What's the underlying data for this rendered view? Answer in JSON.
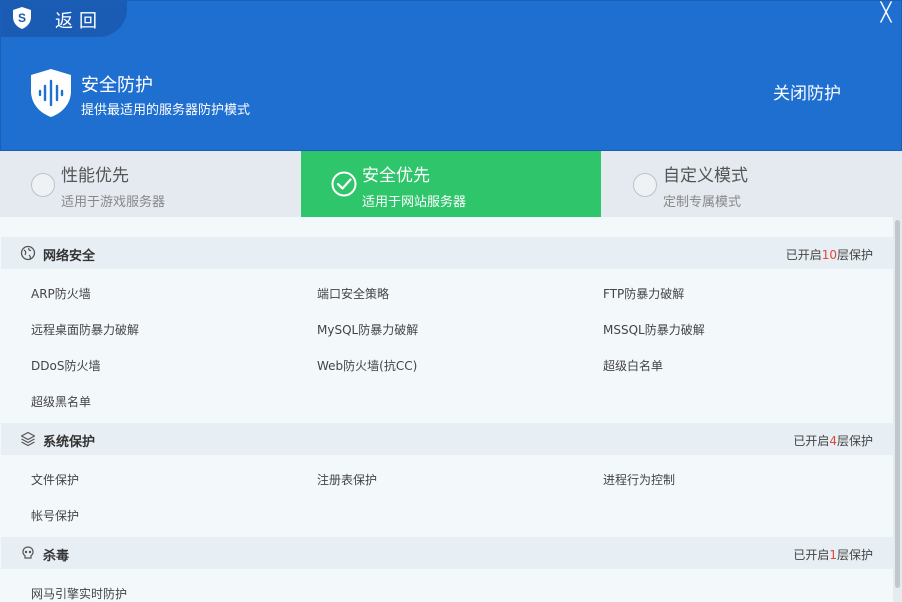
{
  "header": {
    "back_label": "返回",
    "close_glyph": "╳",
    "title": "安全防护",
    "subtitle": "提供最适用的服务器防护模式",
    "close_protect_label": "关闭防护",
    "bg_color": "#1f6fd1"
  },
  "modes": [
    {
      "title": "性能优先",
      "subtitle": "适用于游戏服务器",
      "selected": false
    },
    {
      "title": "安全优先",
      "subtitle": "适用于网站服务器",
      "selected": true
    },
    {
      "title": "自定义模式",
      "subtitle": "定制专属模式",
      "selected": false
    }
  ],
  "accent_color": "#2fc56b",
  "sections": [
    {
      "icon": "globe-icon",
      "title": "网络安全",
      "status_prefix": "已开启",
      "count": "10",
      "status_suffix": "层保护",
      "items": [
        "ARP防火墙",
        "端口安全策略",
        "FTP防暴力破解",
        "远程桌面防暴力破解",
        "MySQL防暴力破解",
        "MSSQL防暴力破解",
        "DDoS防火墙",
        "Web防火墙(抗CC)",
        "超级白名单",
        "超级黑名单"
      ]
    },
    {
      "icon": "layers-icon",
      "title": "系统保护",
      "status_prefix": "已开启",
      "count": "4",
      "status_suffix": "层保护",
      "items": [
        "文件保护",
        "注册表保护",
        "进程行为控制",
        "帐号保护"
      ]
    },
    {
      "icon": "virus-icon",
      "title": "杀毒",
      "status_prefix": "已开启",
      "count": "1",
      "status_suffix": "层保护",
      "items": [
        "网马引擎实时防护"
      ]
    }
  ]
}
